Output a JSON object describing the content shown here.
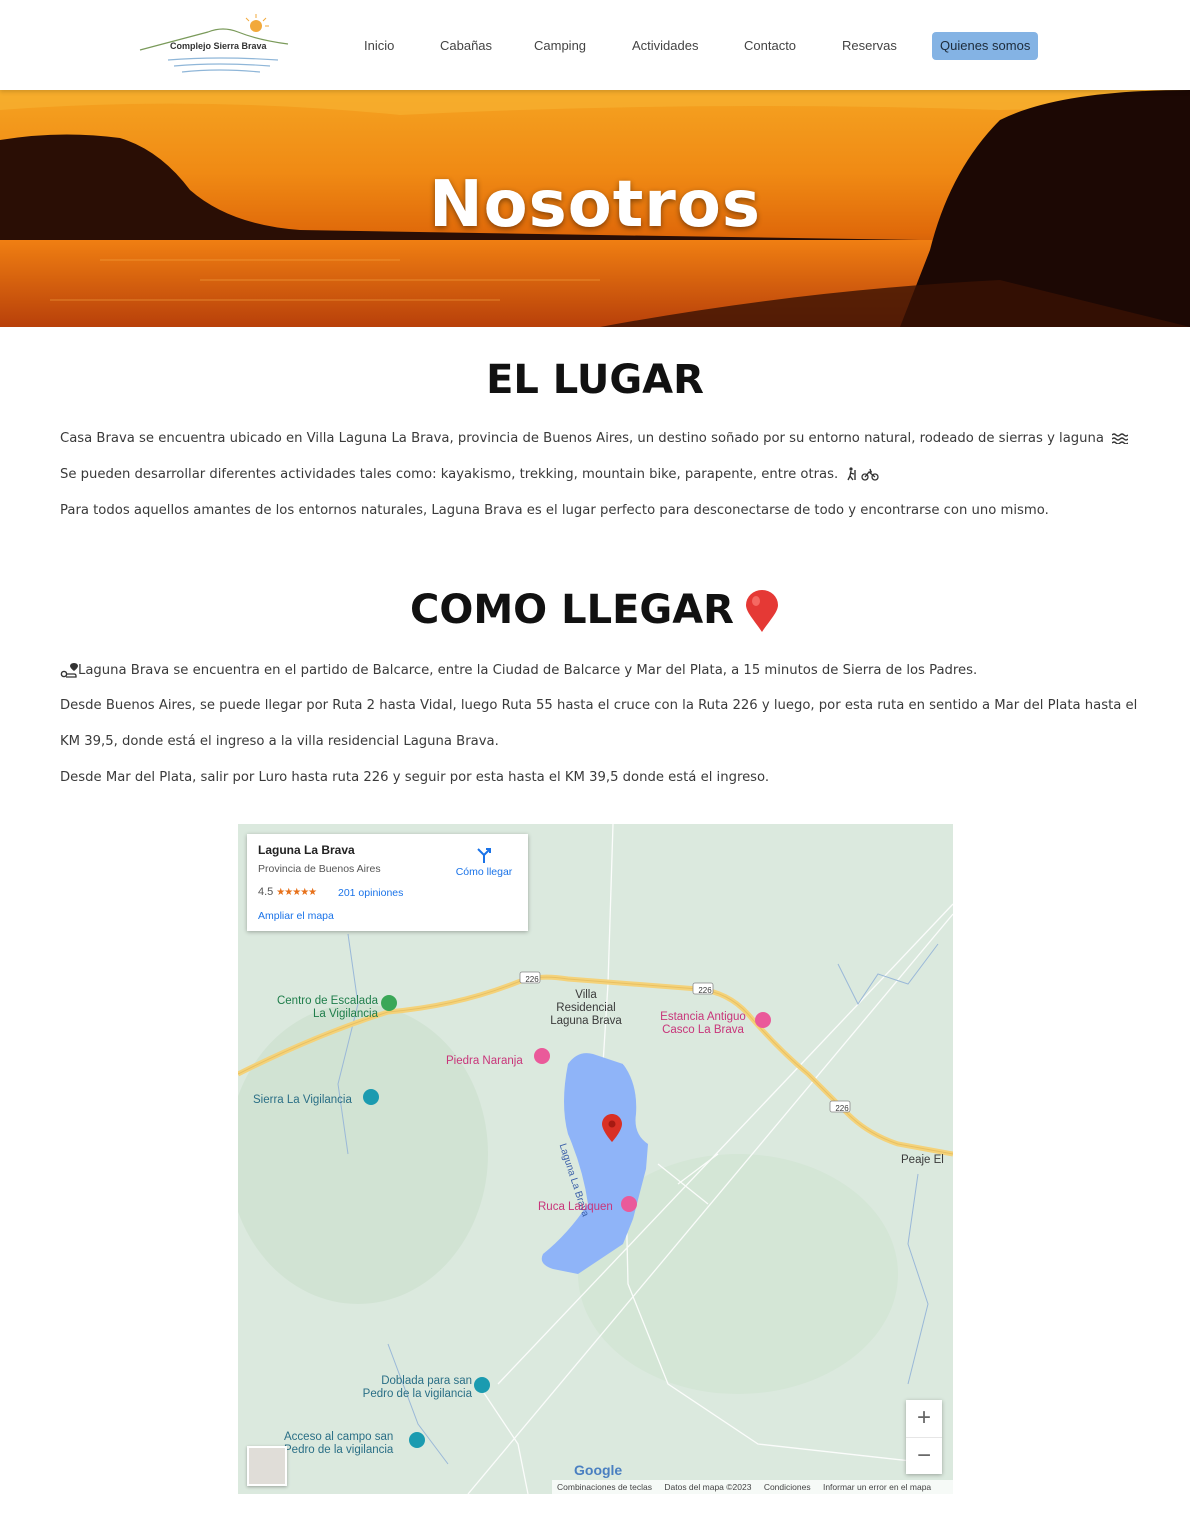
{
  "header": {
    "logo_text": "Complejo Sierra Brava",
    "nav": [
      {
        "label": "Inicio"
      },
      {
        "label": "Cabañas"
      },
      {
        "label": "Camping"
      },
      {
        "label": "Actividades"
      },
      {
        "label": "Contacto"
      },
      {
        "label": "Reservas"
      },
      {
        "label": "Quienes somos",
        "active": true
      }
    ]
  },
  "hero": {
    "title": "Nosotros"
  },
  "section1": {
    "title": "EL LUGAR",
    "paragraphs": [
      "Casa Brava se encuentra ubicado en Villa Laguna La Brava, provincia de Buenos Aires, un destino soñado por su entorno natural, rodeado de sierras y laguna",
      "Se pueden desarrollar diferentes actividades tales como: kayakismo, trekking, mountain bike, parapente, entre otras.",
      "Para todos aquellos amantes de los entornos naturales, Laguna Brava es el lugar perfecto para desconectarse de todo y encontrarse con uno mismo."
    ]
  },
  "section2": {
    "title": "COMO LLEGAR",
    "paragraphs": [
      "Laguna Brava se encuentra en el partido de Balcarce, entre la Ciudad de Balcarce y Mar del Plata, a 15 minutos de Sierra de los Padres.",
      "Desde Buenos Aires, se puede llegar por Ruta 2 hasta Vidal, luego Ruta 55 hasta el cruce con la Ruta 226 y luego, por esta ruta en sentido a Mar del Plata hasta el",
      "KM 39,5, donde está el ingreso a la villa residencial Laguna Brava.",
      "Desde Mar del Plata, salir por Luro hasta ruta 226 y seguir por esta hasta el KM 39,5 donde está el ingreso."
    ]
  },
  "map": {
    "card": {
      "title": "Laguna La Brava",
      "subtitle": "Provincia de Buenos Aires",
      "rating": "4.5",
      "stars": "★★★★★",
      "reviews": "201 opiniones",
      "enlarge": "Ampliar el mapa",
      "directions": "Cómo llegar"
    },
    "labels": {
      "escalada_1": "Centro de Escalada",
      "escalada_2": "La Vigilancia",
      "villa_1": "Villa",
      "villa_2": "Residencial",
      "villa_3": "Laguna Brava",
      "estancia_1": "Estancia Antiguo",
      "estancia_2": "Casco La Brava",
      "piedra": "Piedra Naranja",
      "sierra": "Sierra La Vigilancia",
      "laguna": "Laguna La Brava",
      "ruca": "Ruca Lauquen",
      "peaje": "Peaje El",
      "doblada_1": "Doblada para san",
      "doblada_2": "Pedro de la vigilancia",
      "acceso_1": "Acceso al campo san",
      "acceso_2": "Pedro de la vigilancia",
      "route": "226"
    },
    "zoom_in": "+",
    "zoom_out": "−",
    "google": "Google",
    "footer": {
      "shortcuts": "Combinaciones de teclas",
      "data": "Datos del mapa ©2023",
      "terms": "Condiciones",
      "report": "Informar un error en el mapa"
    }
  },
  "colors": {
    "nav_active": "#84b3e4",
    "lake": "#8fb4f8",
    "road": "#f4d27a",
    "map_bg": "#dbe9de",
    "link": "#1a73e8"
  }
}
